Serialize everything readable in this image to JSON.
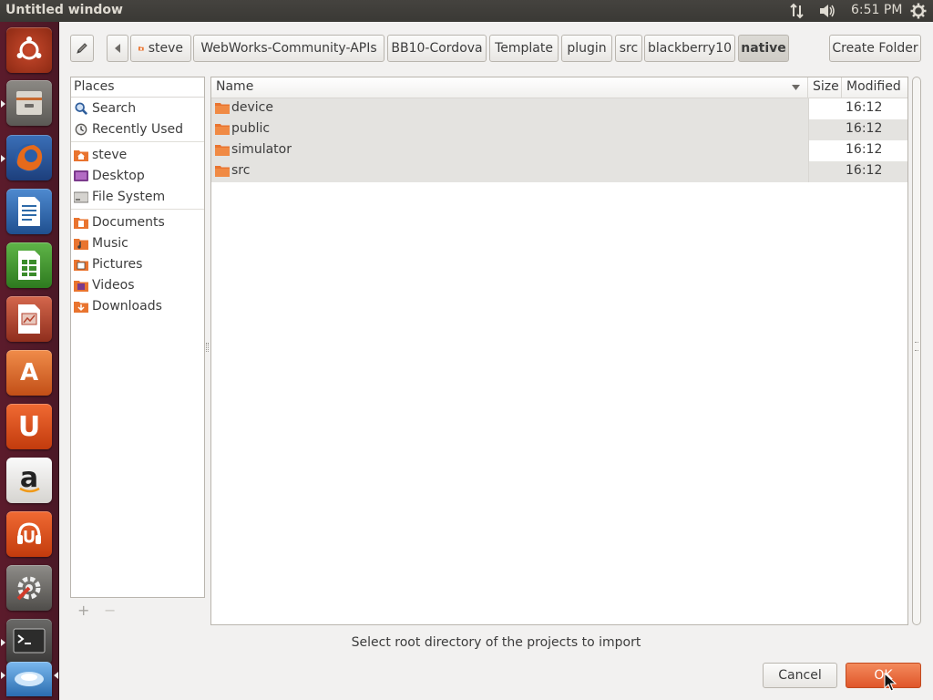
{
  "window": {
    "title": "Untitled window"
  },
  "panel": {
    "clock": "6:51 PM",
    "network_icon": "network-transfer-icon",
    "volume_icon": "volume-icon",
    "settings_icon": "gear-icon"
  },
  "launcher": {
    "items": [
      {
        "name": "ubuntu-dash-icon",
        "color": "#b03a1d"
      },
      {
        "name": "file-manager-icon",
        "color": "#6d6a66"
      },
      {
        "name": "firefox-icon",
        "color": "#e2661c"
      },
      {
        "name": "libreoffice-writer-icon",
        "color": "#2e6aa8"
      },
      {
        "name": "libreoffice-calc-icon",
        "color": "#3a8b2a"
      },
      {
        "name": "libreoffice-impress-icon",
        "color": "#b4422e"
      },
      {
        "name": "software-center-icon",
        "color": "#e46a2d"
      },
      {
        "name": "ubuntu-one-icon",
        "color": "#dd4814"
      },
      {
        "name": "amazon-icon",
        "color": "#e8e6e3"
      },
      {
        "name": "ubuntu-one-music-icon",
        "color": "#dd4814"
      },
      {
        "name": "system-settings-icon",
        "color": "#6c6b68"
      },
      {
        "name": "terminal-icon",
        "color": "#4b4b49"
      },
      {
        "name": "workspace-switcher-icon",
        "color": "#3f8fd6"
      }
    ],
    "glyphs": {
      "softcenter": "A",
      "ubuntuone": "U",
      "amazon": "a"
    }
  },
  "toolbar": {
    "edit_location_icon": "pencil-icon",
    "back_icon": "left-arrow-icon",
    "home_icon": "home-folder-icon",
    "breadcrumbs": [
      "steve",
      "WebWorks-Community-APIs",
      "BB10-Cordova",
      "Template",
      "plugin",
      "src",
      "blackberry10",
      "native"
    ],
    "active_crumb": "native",
    "create_folder_label": "Create Folder"
  },
  "places": {
    "header": "Places",
    "groups": [
      [
        {
          "label": "Search",
          "icon": "search-icon"
        },
        {
          "label": "Recently Used",
          "icon": "recent-icon"
        }
      ],
      [
        {
          "label": "steve",
          "icon": "home-folder-icon"
        },
        {
          "label": "Desktop",
          "icon": "desktop-icon"
        },
        {
          "label": "File System",
          "icon": "drive-icon"
        }
      ],
      [
        {
          "label": "Documents",
          "icon": "documents-folder-icon"
        },
        {
          "label": "Music",
          "icon": "music-folder-icon"
        },
        {
          "label": "Pictures",
          "icon": "pictures-folder-icon"
        },
        {
          "label": "Videos",
          "icon": "videos-folder-icon"
        },
        {
          "label": "Downloads",
          "icon": "downloads-folder-icon"
        }
      ]
    ],
    "add_label": "+",
    "remove_label": "−"
  },
  "files": {
    "columns": {
      "name": "Name",
      "size": "Size",
      "modified": "Modified"
    },
    "sort_icon": "sort-down-icon",
    "rows": [
      {
        "name": "device",
        "size": "",
        "modified": "16:12"
      },
      {
        "name": "public",
        "size": "",
        "modified": "16:12"
      },
      {
        "name": "simulator",
        "size": "",
        "modified": "16:12"
      },
      {
        "name": "src",
        "size": "",
        "modified": "16:12"
      }
    ]
  },
  "status_text": "Select root directory of the projects to import",
  "buttons": {
    "cancel": "Cancel",
    "ok": "OK"
  },
  "colors": {
    "accent_orange": "#ea6d3a",
    "folder_orange": "#e9742f",
    "launcher_bg": "#5b1b2b"
  }
}
